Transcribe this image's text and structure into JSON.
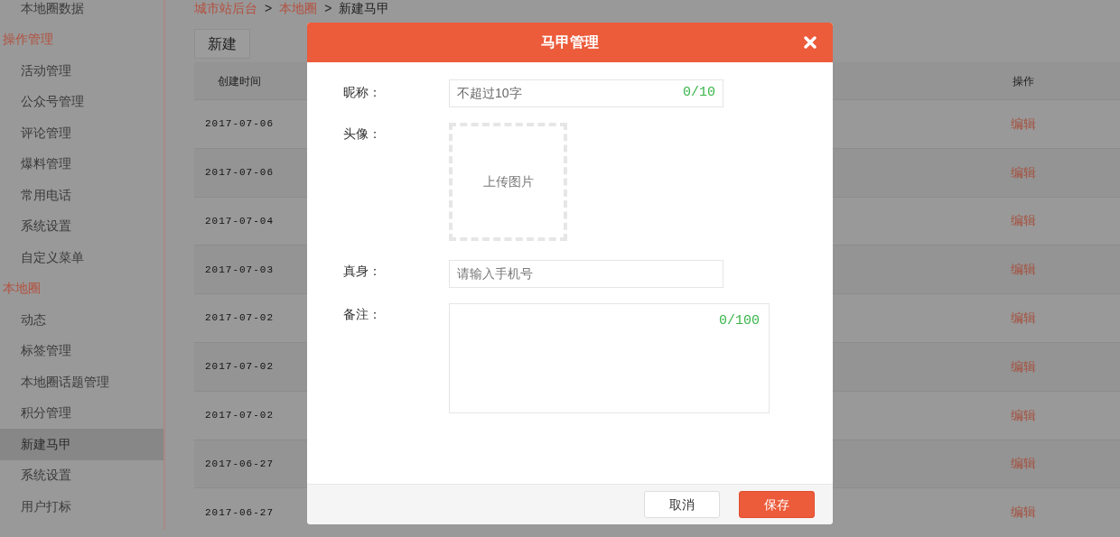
{
  "sidebar": {
    "groups": [
      {
        "items": [
          {
            "label": "本地圈数据",
            "selected": false
          }
        ]
      },
      {
        "title": "操作管理",
        "items": [
          {
            "label": "活动管理",
            "selected": false
          },
          {
            "label": "公众号管理",
            "selected": false
          },
          {
            "label": "评论管理",
            "selected": false
          },
          {
            "label": "爆料管理",
            "selected": false
          },
          {
            "label": "常用电话",
            "selected": false
          },
          {
            "label": "系统设置",
            "selected": false
          },
          {
            "label": "自定义菜单",
            "selected": false
          }
        ]
      },
      {
        "title": "本地圈",
        "items": [
          {
            "label": "动态",
            "selected": false
          },
          {
            "label": "标签管理",
            "selected": false
          },
          {
            "label": "本地圈话题管理",
            "selected": false
          },
          {
            "label": "积分管理",
            "selected": false
          },
          {
            "label": "新建马甲",
            "selected": true
          },
          {
            "label": "系统设置",
            "selected": false
          },
          {
            "label": "用户打标",
            "selected": false
          }
        ]
      }
    ]
  },
  "breadcrumb_separator": ">",
  "breadcrumb": [
    {
      "label": "城市站后台",
      "kind": "link"
    },
    {
      "label": "本地圈",
      "kind": "link"
    },
    {
      "label": "新建马甲",
      "kind": "current"
    }
  ],
  "new_button": "新建",
  "table": {
    "columns": [
      "创建时间",
      "操作"
    ],
    "rows": [
      {
        "date": "2017-07-06",
        "action": "编辑"
      },
      {
        "date": "2017-07-06",
        "action": "编辑"
      },
      {
        "date": "2017-07-04",
        "action": "编辑"
      },
      {
        "date": "2017-07-03",
        "action": "编辑"
      },
      {
        "date": "2017-07-02",
        "action": "编辑"
      },
      {
        "date": "2017-07-02",
        "action": "编辑"
      },
      {
        "date": "2017-07-02",
        "action": "编辑"
      },
      {
        "date": "2017-06-27",
        "action": "编辑"
      },
      {
        "date": "2017-06-27",
        "action": "编辑"
      }
    ]
  },
  "modal": {
    "title": "马甲管理",
    "nickname": {
      "label": "昵称：",
      "placeholder": "不超过10字",
      "counter": "0/10"
    },
    "avatar": {
      "label": "头像：",
      "upload": "上传图片"
    },
    "identity": {
      "label": "真身：",
      "placeholder": "请输入手机号"
    },
    "remark": {
      "label": "备注：",
      "counter": "0/100"
    },
    "buttons": [
      {
        "label": "取消",
        "kind": "secondary"
      },
      {
        "label": "保存",
        "kind": "primary"
      }
    ]
  }
}
